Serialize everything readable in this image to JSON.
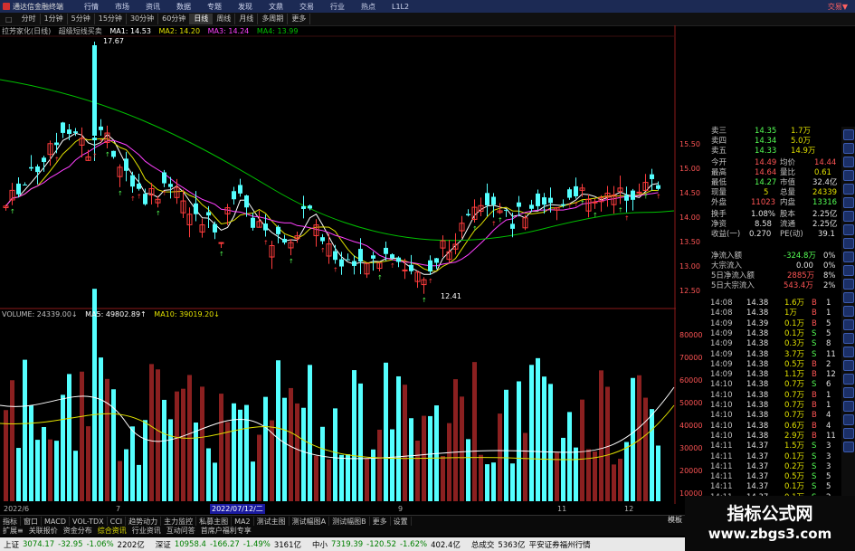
{
  "titlebar": {
    "app_title": "通达信金融终端",
    "menus": [
      "行情",
      "市场",
      "资讯",
      "数据",
      "专题",
      "发现",
      "文鼎",
      "交易",
      "行业",
      "热点",
      "L1L2"
    ],
    "trade": "交易▼"
  },
  "toolbar": {
    "first": "□",
    "periods": [
      "分时",
      "1分钟",
      "5分钟",
      "15分钟",
      "30分钟",
      "60分钟",
      "日线",
      "周线",
      "月线",
      "多周期",
      "更多"
    ],
    "active": "日线"
  },
  "price_legend": {
    "name": "拉芳家化(日线)",
    "indicator": "超级短线买卖",
    "ma1": "MA1: 14.53",
    "ma2": "MA2: 14.20",
    "ma3": "MA3: 14.24",
    "ma4": "MA4: 13.99",
    "high_mark": "17.67",
    "low_mark": "12.41"
  },
  "vol_legend": {
    "volume": "VOLUME: 24339.00↓",
    "ma5": "MA5: 49802.89↑",
    "ma10": "MA10: 39019.20↓"
  },
  "colors": {
    "up": "#ff3c3c",
    "down": "#54ffff",
    "ma1": "#ffffff",
    "ma2": "#e0e000",
    "ma3": "#ff40ff",
    "ma4": "#00c000"
  },
  "price_axis": [
    "15.50",
    "15.00",
    "14.50",
    "14.00",
    "13.50",
    "13.00",
    "12.50"
  ],
  "vol_axis": [
    "80000",
    "70000",
    "60000",
    "50000",
    "40000",
    "30000",
    "20000",
    "10000"
  ],
  "dates": {
    "d1": "2022/6",
    "d2": "7",
    "d3": "2022/07/12/二",
    "d4": "9",
    "d5": "11",
    "d6": "12"
  },
  "quote": [
    {
      "label": "卖三",
      "price": "14.35",
      "vol": "1.7万"
    },
    {
      "label": "卖四",
      "price": "14.34",
      "vol": "5.0万"
    },
    {
      "label": "卖五",
      "price": "14.33",
      "vol": "14.9万"
    },
    {
      "label": "今开",
      "price": "14.49",
      "label2": "均价",
      "val2": "14.44"
    },
    {
      "label": "最高",
      "price": "14.64",
      "label2": "量比",
      "val2": "0.61"
    },
    {
      "label": "最低",
      "price": "14.27",
      "label2": "市值",
      "val2": "32.4亿"
    },
    {
      "label": "现量",
      "price": "5",
      "label2": "总量",
      "val2": "24339"
    },
    {
      "label": "外盘",
      "price": "11023",
      "label2": "内盘",
      "val2": "13316"
    },
    {
      "label": "换手",
      "price": "1.08%",
      "label2": "股本",
      "val2": "2.25亿"
    },
    {
      "label": "净资",
      "price": "8.58",
      "label2": "流通",
      "val2": "2.25亿"
    },
    {
      "label": "收益(一)",
      "price": "0.270",
      "label2": "PE(动)",
      "val2": "39.1"
    }
  ],
  "flow": [
    {
      "label": "净流入额",
      "val": "-324.8万",
      "pct": "0%"
    },
    {
      "label": "大宗流入",
      "val": "0.00",
      "pct": "0%"
    },
    {
      "label": "5日净流入额",
      "val": "2885万",
      "pct": "8%"
    },
    {
      "label": "5日大宗流入",
      "val": "543.4万",
      "pct": "2%"
    }
  ],
  "ticks": [
    {
      "time": "14:08",
      "price": "14.38",
      "vol": "1.6万",
      "bs": "B",
      "n": "1"
    },
    {
      "time": "14:08",
      "price": "14.38",
      "vol": "1万",
      "bs": "B",
      "n": "1"
    },
    {
      "time": "14:09",
      "price": "14.39",
      "vol": "0.1万",
      "bs": "B",
      "n": "5"
    },
    {
      "time": "14:09",
      "price": "14.38",
      "vol": "0.1万",
      "bs": "S",
      "n": "5"
    },
    {
      "time": "14:09",
      "price": "14.38",
      "vol": "0.3万",
      "bs": "S",
      "n": "8"
    },
    {
      "time": "14:09",
      "price": "14.38",
      "vol": "3.7万",
      "bs": "S",
      "n": "11"
    },
    {
      "time": "14:09",
      "price": "14.38",
      "vol": "0.5万",
      "bs": "B",
      "n": "2"
    },
    {
      "time": "14:09",
      "price": "14.38",
      "vol": "1.1万",
      "bs": "B",
      "n": "12"
    },
    {
      "time": "14:10",
      "price": "14.38",
      "vol": "0.7万",
      "bs": "S",
      "n": "6"
    },
    {
      "time": "14:10",
      "price": "14.38",
      "vol": "0.7万",
      "bs": "B",
      "n": "1"
    },
    {
      "time": "14:10",
      "price": "14.38",
      "vol": "0.7万",
      "bs": "B",
      "n": "1"
    },
    {
      "time": "14:10",
      "price": "14.38",
      "vol": "0.7万",
      "bs": "B",
      "n": "4"
    },
    {
      "time": "14:10",
      "price": "14.38",
      "vol": "0.6万",
      "bs": "B",
      "n": "4"
    },
    {
      "time": "14:10",
      "price": "14.38",
      "vol": "2.9万",
      "bs": "B",
      "n": "11"
    },
    {
      "time": "14:11",
      "price": "14.37",
      "vol": "1.5万",
      "bs": "S",
      "n": "3"
    },
    {
      "time": "14:11",
      "price": "14.37",
      "vol": "0.1万",
      "bs": "S",
      "n": "3"
    },
    {
      "time": "14:11",
      "price": "14.37",
      "vol": "0.2万",
      "bs": "S",
      "n": "3"
    },
    {
      "time": "14:11",
      "price": "14.37",
      "vol": "0.5万",
      "bs": "S",
      "n": "5"
    },
    {
      "time": "14:11",
      "price": "14.37",
      "vol": "0.1万",
      "bs": "S",
      "n": "5"
    },
    {
      "time": "14:11",
      "price": "14.37",
      "vol": "0.1万",
      "bs": "S",
      "n": "2"
    }
  ],
  "bottom_tabs": [
    "指标",
    "窗口",
    "MACD",
    "VOL-TDX",
    "CCI",
    "趋势动力",
    "主力监控",
    "私募主图",
    "MA2",
    "测试主图",
    "测试幅图A",
    "测试幅图B",
    "更多",
    "设置"
  ],
  "bottom_tabs2": [
    "扩展≡",
    "关联报价",
    "资金分布",
    "综合资讯",
    "行业资讯",
    "互动问答",
    "首席户福利专享"
  ],
  "right_ctl": "模板",
  "status": {
    "sh_name": "上证",
    "sh_val": "3074.17",
    "sh_chg": "-32.95",
    "sh_pct": "-1.06%",
    "sh_amt": "2202亿",
    "sz_name": "深证",
    "sz_val": "10958.4",
    "sz_chg": "-166.27",
    "sz_pct": "-1.49%",
    "sz_amt": "3161亿",
    "zx_name": "中小",
    "zx_val": "7319.39",
    "zx_chg": "-120.52",
    "zx_pct": "-1.62%",
    "zx_amt": "402.4亿",
    "total_label": "总成交",
    "total_val": "5363亿",
    "broker": "平安证券福州行情"
  },
  "watermark": {
    "cn": "指标公式网",
    "url": "www.zbgs3.com"
  }
}
